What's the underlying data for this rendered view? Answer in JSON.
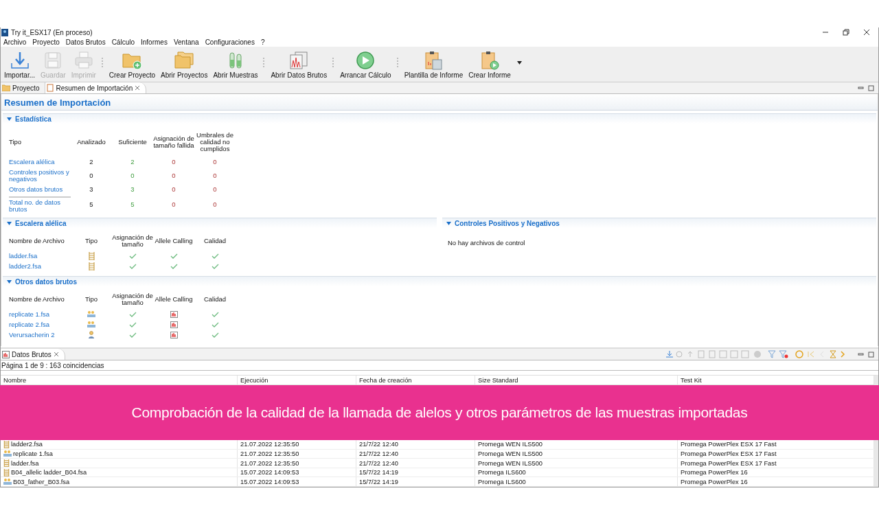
{
  "window": {
    "title": "Try it_ESX17 (En proceso)"
  },
  "menu": [
    "Archivo",
    "Proyecto",
    "Datos Brutos",
    "Cálculo",
    "Informes",
    "Ventana",
    "Configuraciones",
    "?"
  ],
  "toolbar": [
    {
      "label": "Importar...",
      "kind": "import",
      "disabled": false,
      "separator_before": false
    },
    {
      "label": "Guardar",
      "kind": "save",
      "disabled": true,
      "separator_before": false
    },
    {
      "label": "Imprimir",
      "kind": "print",
      "disabled": true,
      "separator_before": false
    },
    {
      "label": "Crear Proyecto",
      "kind": "new-folder",
      "disabled": false,
      "separator_before": true
    },
    {
      "label": "Abrir Proyectos",
      "kind": "folders",
      "disabled": false,
      "separator_before": false
    },
    {
      "label": "Abrir Muestras",
      "kind": "tubes",
      "disabled": false,
      "separator_before": false
    },
    {
      "label": "Abrir Datos Brutos",
      "kind": "charts",
      "disabled": false,
      "separator_before": true
    },
    {
      "label": "Arrancar Cálculo",
      "kind": "play",
      "disabled": false,
      "separator_before": true
    },
    {
      "label": "Plantilla de Informe",
      "kind": "report-template",
      "disabled": false,
      "separator_before": true
    },
    {
      "label": "Crear Informe",
      "kind": "report",
      "disabled": false,
      "separator_before": false
    }
  ],
  "editor_tabs": [
    {
      "label": "Proyecto",
      "kind": "folder",
      "selected": false
    },
    {
      "label": "Resumen de Importación",
      "kind": "doc",
      "selected": true
    }
  ],
  "page_title": "Resumen de Importación",
  "statistics": {
    "title": "Estadística",
    "columns": [
      "Tipo",
      "Analizado",
      "Suficiente",
      "Asignación de tamaño fallida",
      "Umbrales de calidad no cumplidos"
    ],
    "rows": [
      {
        "type": "Escalera alélica",
        "values": [
          "2",
          "2",
          "0",
          "0"
        ]
      },
      {
        "type": "Controles positivos y negativos",
        "values": [
          "0",
          "0",
          "0",
          "0"
        ]
      },
      {
        "type": "Otros datos brutos",
        "values": [
          "3",
          "3",
          "0",
          "0"
        ]
      },
      {
        "type": "Total no. de datos brutos",
        "values": [
          "5",
          "5",
          "0",
          "0"
        ]
      }
    ]
  },
  "ladder_section": {
    "title": "Escalera alélica",
    "columns": [
      "Nombre de Archivo",
      "Tipo",
      "Asignación de tamaño",
      "Allele Calling",
      "Calidad"
    ],
    "rows": [
      {
        "name": "ladder.fsa",
        "kind": "ladder",
        "cells": [
          {
            "kind": "check"
          },
          {
            "kind": "check"
          },
          {
            "kind": "check"
          }
        ]
      },
      {
        "name": "ladder2.fsa",
        "kind": "ladder",
        "cells": [
          {
            "kind": "check"
          },
          {
            "kind": "check"
          },
          {
            "kind": "check"
          }
        ]
      }
    ]
  },
  "controls_section": {
    "title": "Controles Positivos y Negativos",
    "message": "No hay archivos de control"
  },
  "other_section": {
    "title": "Otros datos brutos",
    "columns": [
      "Nombre de Archivo",
      "Tipo",
      "Asignación de tamaño",
      "Allele Calling",
      "Calidad"
    ],
    "rows": [
      {
        "name": "replicate 1.fsa",
        "kind": "sample",
        "cells": [
          {
            "kind": "check"
          },
          {
            "kind": "chart"
          },
          {
            "kind": "check"
          }
        ]
      },
      {
        "name": "replicate 2.fsa",
        "kind": "sample",
        "cells": [
          {
            "kind": "check"
          },
          {
            "kind": "chart"
          },
          {
            "kind": "check"
          }
        ]
      },
      {
        "name": "Verursacherin 2",
        "kind": "person",
        "cells": [
          {
            "kind": "check"
          },
          {
            "kind": "chart"
          },
          {
            "kind": "check"
          }
        ]
      }
    ]
  },
  "raw_data": {
    "tab": "Datos Brutos",
    "page_info": "Página 1 de 9 : 163 coincidencias",
    "columns": [
      "Nombre",
      "Ejecución",
      "Fecha de creación",
      "Size Standard",
      "Test Kit"
    ],
    "rows": [
      {
        "kind": "ladder",
        "cells": [
          "ladder2.fsa",
          "21.07.2022 12:35:50",
          "21/7/22 12:40",
          "Promega WEN ILS500",
          "Promega PowerPlex ESX 17 Fast"
        ]
      },
      {
        "kind": "sample",
        "cells": [
          "replicate 1.fsa",
          "21.07.2022 12:35:50",
          "21/7/22 12:40",
          "Promega WEN ILS500",
          "Promega PowerPlex ESX 17 Fast"
        ]
      },
      {
        "kind": "ladder",
        "cells": [
          "ladder.fsa",
          "21.07.2022 12:35:50",
          "21/7/22 12:40",
          "Promega WEN ILS500",
          "Promega PowerPlex ESX 17 Fast"
        ]
      },
      {
        "kind": "ladder",
        "cells": [
          "B04_allelic ladder_B04.fsa",
          "15.07.2022 14:09:53",
          "15/7/22 14:19",
          "Promega ILS600",
          "Promega PowerPlex 16"
        ]
      },
      {
        "kind": "sample",
        "cells": [
          "B03_father_B03.fsa",
          "15.07.2022 14:09:53",
          "15/7/22 14:19",
          "Promega ILS600",
          "Promega PowerPlex 16"
        ]
      }
    ]
  },
  "caption": "Comprobación de la calidad de la llamada de alelos y otros parámetros de las muestras importadas"
}
